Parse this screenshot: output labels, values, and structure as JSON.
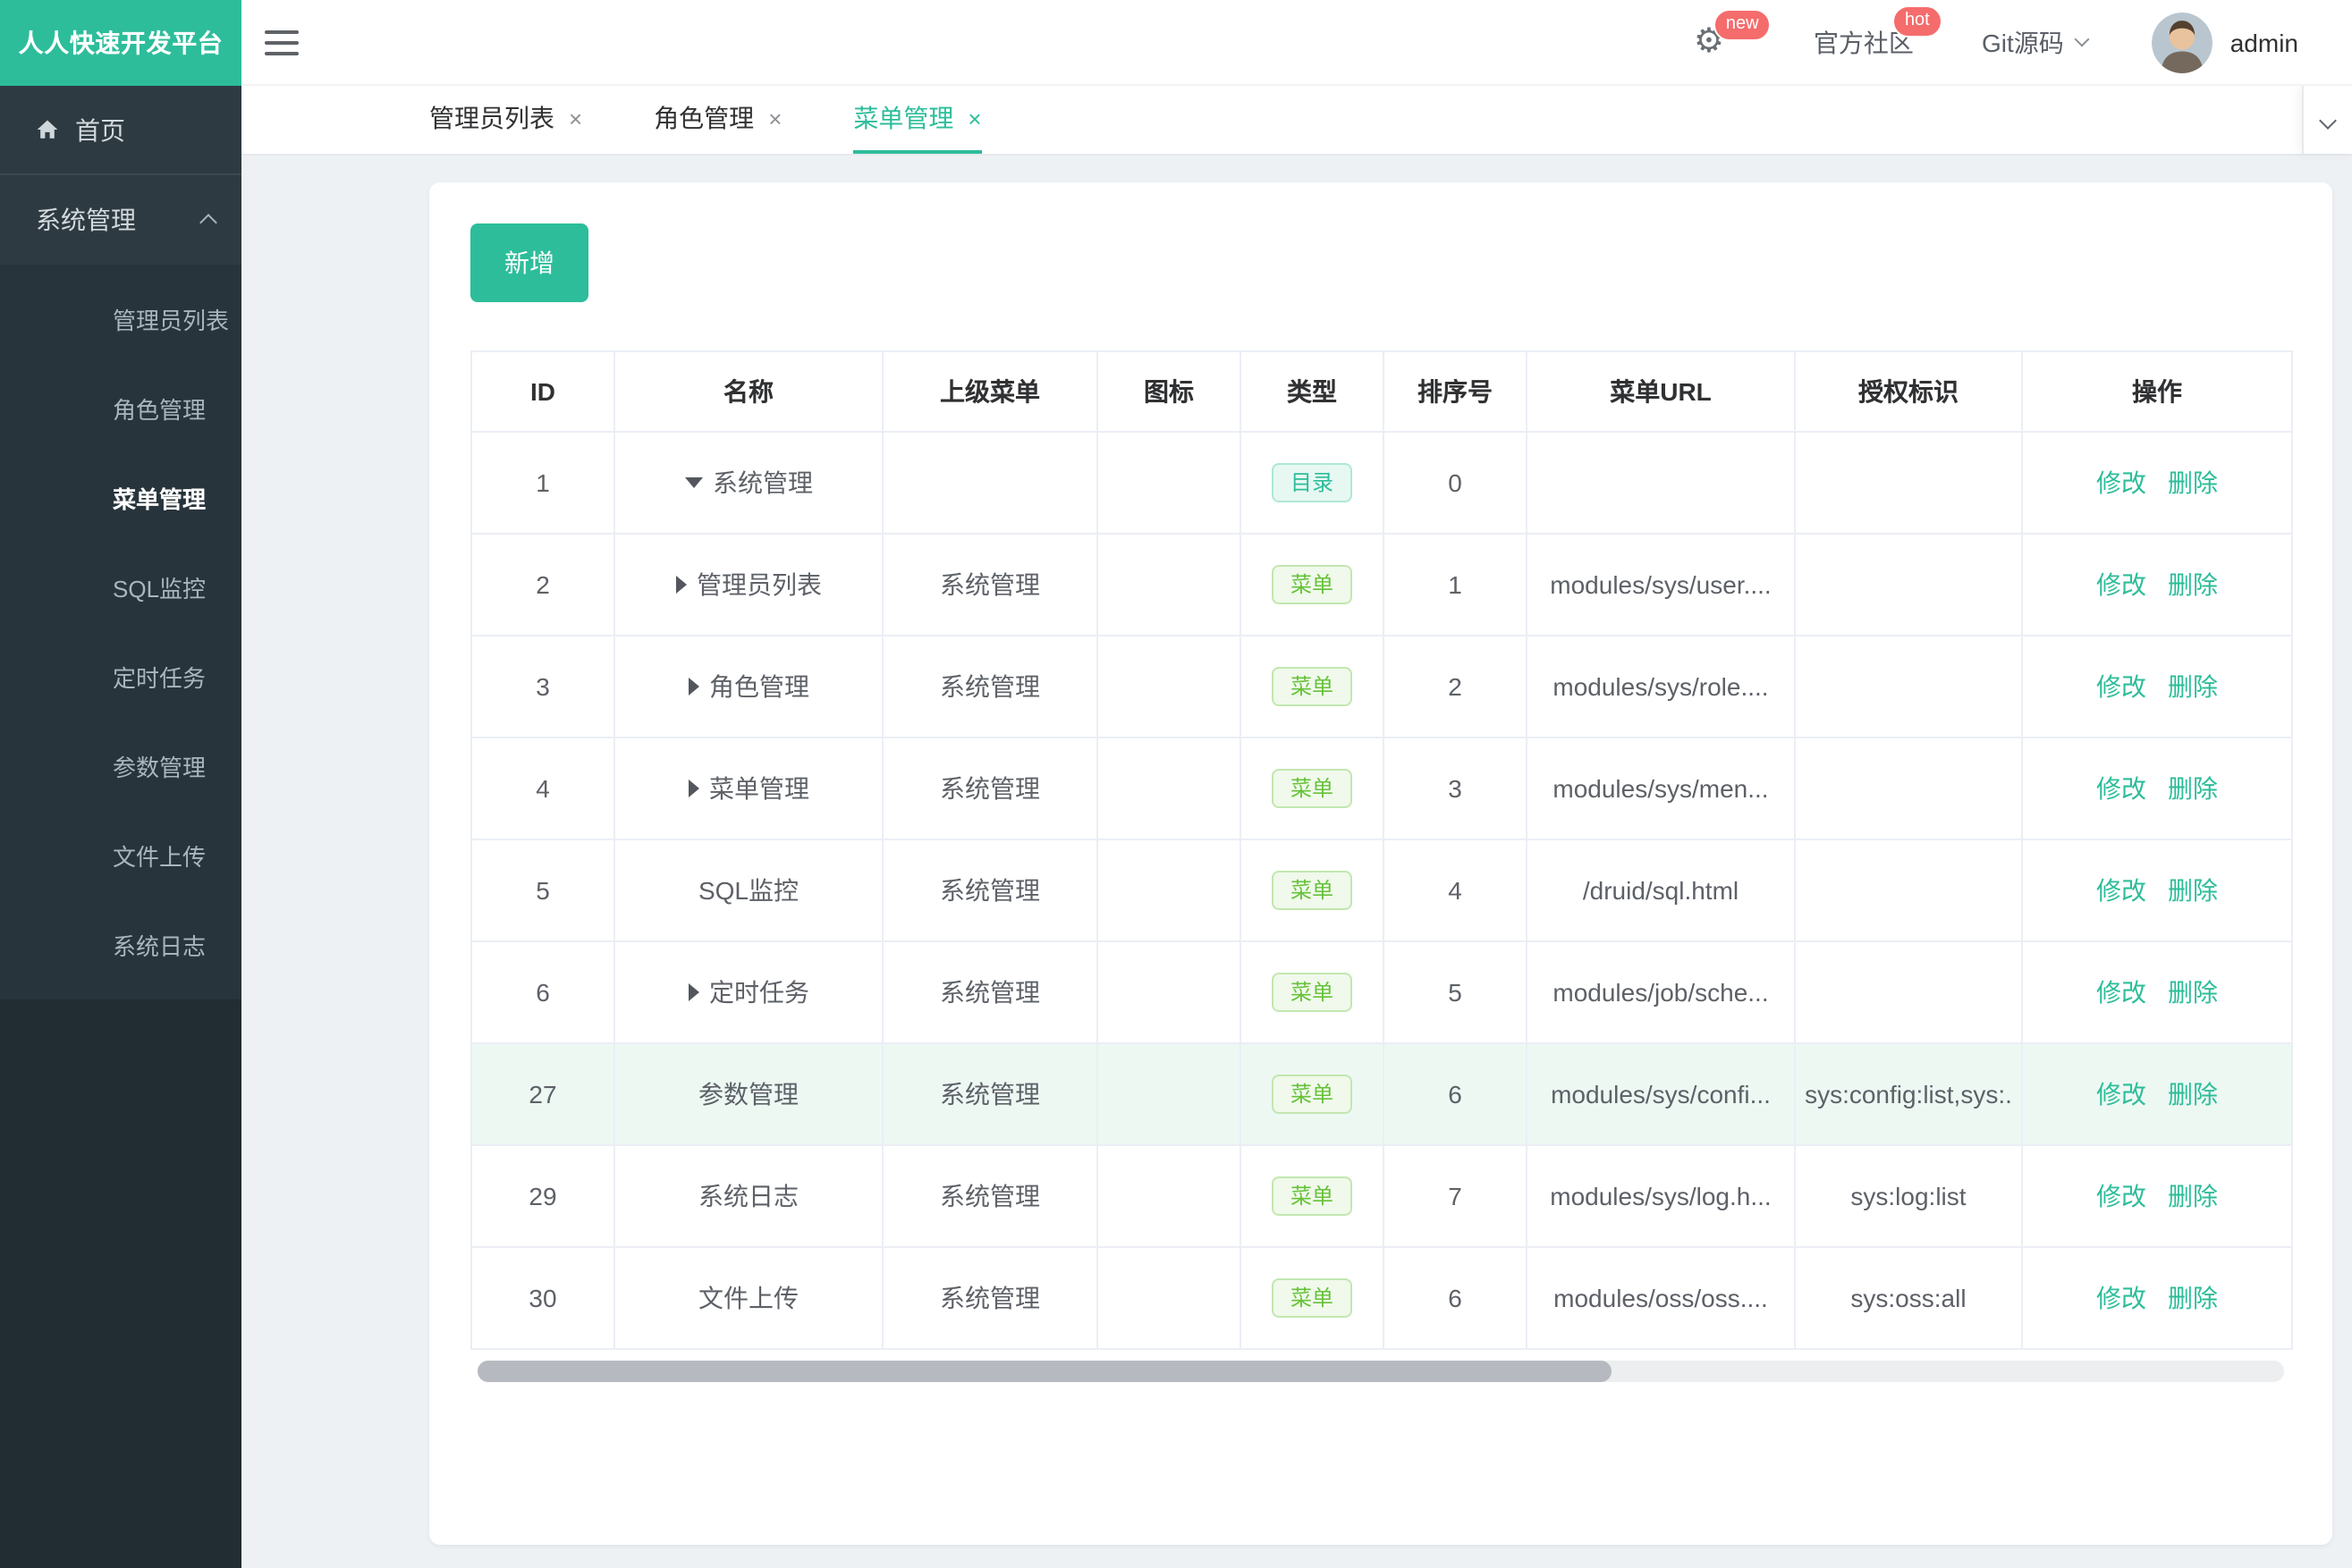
{
  "brand": {
    "title": "人人快速开发平台"
  },
  "colors": {
    "accent": "#2dbd9a",
    "badge": "#f56c6c",
    "tag_menu_green": "#67c23a"
  },
  "icons": {
    "close": "×",
    "gear": "⚙"
  },
  "topbar": {
    "community_label": "官方社区",
    "git_label": "Git源码",
    "username": "admin",
    "new_badge": "new",
    "hot_badge": "hot"
  },
  "tabs": {
    "items": [
      {
        "label": "管理员列表"
      },
      {
        "label": "角色管理"
      },
      {
        "label": "菜单管理"
      }
    ]
  },
  "sidebar": {
    "home_label": "首页",
    "group_label": "系统管理",
    "items": [
      {
        "label": "管理员列表"
      },
      {
        "label": "角色管理"
      },
      {
        "label": "菜单管理"
      },
      {
        "label": "SQL监控"
      },
      {
        "label": "定时任务"
      },
      {
        "label": "参数管理"
      },
      {
        "label": "文件上传"
      },
      {
        "label": "系统日志"
      }
    ],
    "active_item": "菜单管理"
  },
  "toolbar": {
    "add_label": "新增"
  },
  "table": {
    "headers": [
      "ID",
      "名称",
      "上级菜单",
      "图标",
      "类型",
      "排序号",
      "菜单URL",
      "授权标识",
      "操作"
    ],
    "actions": {
      "edit": "修改",
      "delete": "删除"
    },
    "tag_labels": {
      "dir": "目录",
      "menu": "菜单"
    },
    "rows": [
      {
        "id": "1",
        "name": "系统管理",
        "parent": "",
        "order": "0",
        "url": "",
        "perms": ""
      },
      {
        "id": "2",
        "name": "管理员列表",
        "parent": "系统管理",
        "order": "1",
        "url": "modules/sys/user....",
        "perms": ""
      },
      {
        "id": "3",
        "name": "角色管理",
        "parent": "系统管理",
        "order": "2",
        "url": "modules/sys/role....",
        "perms": ""
      },
      {
        "id": "4",
        "name": "菜单管理",
        "parent": "系统管理",
        "order": "3",
        "url": "modules/sys/men...",
        "perms": ""
      },
      {
        "id": "5",
        "name": "SQL监控",
        "parent": "系统管理",
        "order": "4",
        "url": "/druid/sql.html",
        "perms": ""
      },
      {
        "id": "6",
        "name": "定时任务",
        "parent": "系统管理",
        "order": "5",
        "url": "modules/job/sche...",
        "perms": ""
      },
      {
        "id": "27",
        "name": "参数管理",
        "parent": "系统管理",
        "order": "6",
        "url": "modules/sys/confi...",
        "perms": "sys:config:list,sys:."
      },
      {
        "id": "29",
        "name": "系统日志",
        "parent": "系统管理",
        "order": "7",
        "url": "modules/sys/log.h...",
        "perms": "sys:log:list"
      },
      {
        "id": "30",
        "name": "文件上传",
        "parent": "系统管理",
        "order": "6",
        "url": "modules/oss/oss....",
        "perms": "sys:oss:all"
      }
    ]
  }
}
